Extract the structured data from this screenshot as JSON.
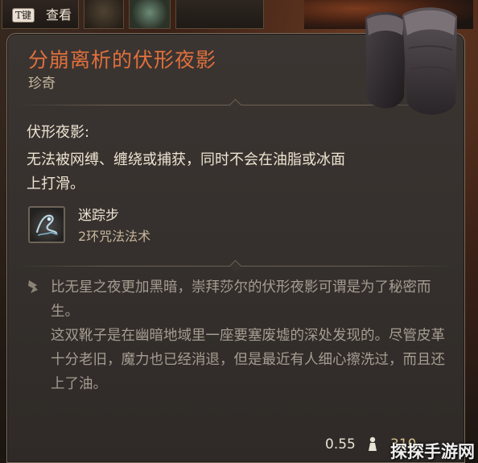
{
  "hotbar": {
    "key_hint": "T键",
    "view_label": "查看"
  },
  "item": {
    "name": "分崩离析的伏形夜影",
    "rarity": "珍奇",
    "trait_heading": "伏形夜影:",
    "trait_description": "无法被网缚、缠绕或捕获，同时不会在油脂或冰面上打滑。",
    "spell": {
      "name": "迷踪步",
      "level": "2环咒法法术",
      "icon": "misty-step-icon"
    },
    "lore": "比无星之夜更加黑暗，崇拜莎尔的伏形夜影可谓是为了秘密而生。\n这双靴子是在幽暗地域里一座要塞废墟的深处发现的。尽管皮革十分老旧，魔力也已经消退，但是最近有人细心擦洗过，而且还上了油。",
    "weight": "0.55",
    "weight_icon": "weight-icon",
    "price": "310"
  },
  "watermark": "探探手游网",
  "colors": {
    "title": "#e0703c",
    "panel": "#35302d",
    "border": "#7a6f60",
    "text": "#ece3d1",
    "lore": "#a59c92"
  }
}
